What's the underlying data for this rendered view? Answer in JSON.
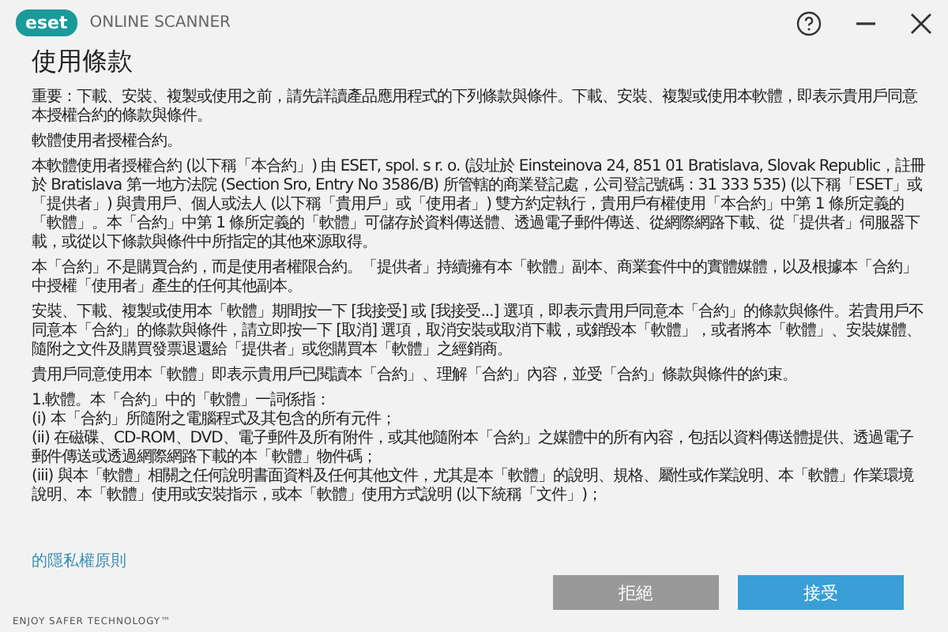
{
  "header": {
    "logo": "eset",
    "product": "ONLINE SCANNER"
  },
  "title": "使用條款",
  "content": [
    {
      "kind": "paragraph",
      "text": "重要：下載、安裝、複製或使用之前，請先詳讀產品應用程式的下列條款與條件。下載、安裝、複製或使用本軟體，即表示貴用戶同意本授權合約的條款與條件。"
    },
    {
      "kind": "paragraph",
      "text": "軟體使用者授權合約。"
    },
    {
      "kind": "paragraph",
      "text": "本軟體使用者授權合約 (以下稱「本合約」) 由 ESET, spol. s r. o. (設址於 Einsteinova 24, 851 01 Bratislava, Slovak Republic，註冊於 Bratislava 第一地方法院 (Section Sro, Entry No 3586/B) 所管轄的商業登記處，公司登記號碼：31 333 535) (以下稱「ESET」或「提供者」) 與貴用戶、個人或法人 (以下稱「貴用戶」或「使用者」) 雙方約定執行，貴用戶有權使用「本合約」中第 1 條所定義的「軟體」。本「合約」中第 1 條所定義的「軟體」可儲存於資料傳送體、透過電子郵件傳送、從網際網路下載、從「提供者」伺服器下載，或從以下條款與條件中所指定的其他來源取得。"
    },
    {
      "kind": "paragraph",
      "text": "本「合約」不是購買合約，而是使用者權限合約。「提供者」持續擁有本「軟體」副本、商業套件中的實體媒體，以及根據本「合約」中授權「使用者」產生的任何其他副本。"
    },
    {
      "kind": "paragraph",
      "text": "安裝、下載、複製或使用本「軟體」期間按一下 [我接受] 或 [我接受...] 選項，即表示貴用戶同意本「合約」的條款與條件。若貴用戶不同意本「合約」的條款與條件，請立即按一下 [取消] 選項，取消安裝或取消下載，或銷毀本「軟體」，或者將本「軟體」、安裝媒體、隨附之文件及購買發票退還給「提供者」或您購買本「軟體」之經銷商。"
    },
    {
      "kind": "paragraph",
      "text": "貴用戶同意使用本「軟體」即表示貴用戶已閱讀本「合約」、理解「合約」內容，並受「合約」條款與條件的約束。"
    },
    {
      "kind": "lines",
      "lines": [
        "1.軟體。本「合約」中的「軟體」一詞係指：",
        "(i) 本「合約」所隨附之電腦程式及其包含的所有元件；",
        "(ii) 在磁碟、CD-ROM、DVD、電子郵件及所有附件，或其他隨附本「合約」之媒體中的所有內容，包括以資料傳送體提供、透過電子郵件傳送或透過網際網路下載的本「軟體」物件碼；",
        "(iii) 與本「軟體」相關之任何說明書面資料及任何其他文件，尤其是本「軟體」的說明、規格、屬性或作業說明、本「軟體」作業環境說明、本「軟體」使用或安裝指示，或本「軟體」使用方式說明 (以下統稱「文件」)；"
      ]
    }
  ],
  "privacy_link": "的隱私權原則",
  "buttons": [
    {
      "label": "拒絕",
      "kind": "secondary"
    },
    {
      "label": "接受",
      "kind": "primary"
    }
  ],
  "footer": "ENJOY SAFER TECHNOLOGY™"
}
